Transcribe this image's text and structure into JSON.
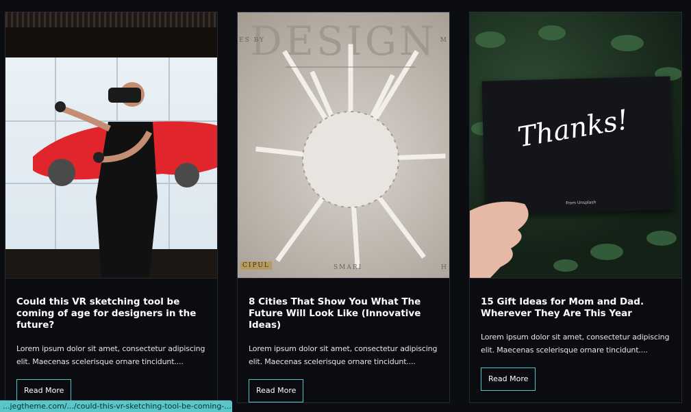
{
  "posts": [
    {
      "title": "Could this VR sketching tool be coming of age for designers in the future?",
      "excerpt": "Lorem ipsum dolor sit amet, consectetur adipiscing elit. Maecenas scelerisque ornare tincidunt....",
      "button": "Read More"
    },
    {
      "title": "8 Cities That Show You What The Future Will Look Like (Innovative Ideas)",
      "excerpt": "Lorem ipsum dolor sit amet, consectetur adipiscing elit. Maecenas scelerisque ornare tincidunt....",
      "button": "Read More",
      "image_text": {
        "heading": "DESIGN",
        "left": "ES BY",
        "right": "M",
        "bottom_left": "CIPUL",
        "bottom_mid": "SMARI",
        "bottom_right": "H"
      }
    },
    {
      "title": "15 Gift Ideas for Mom and Dad. Wherever They Are This Year",
      "excerpt": "Lorem ipsum dolor sit amet, consectetur adipiscing elit. Maecenas scelerisque ornare tincidunt....",
      "button": "Read More",
      "image_text": {
        "script": "Thanks!",
        "from": "From Unsplash"
      }
    }
  ],
  "status_url": "...jegtheme.com/.../could-this-vr-sketching-tool-be-coming-...",
  "colors": {
    "background": "#0b0d11",
    "accent": "#4fc7cc",
    "status_bar": "#59c7c9"
  }
}
